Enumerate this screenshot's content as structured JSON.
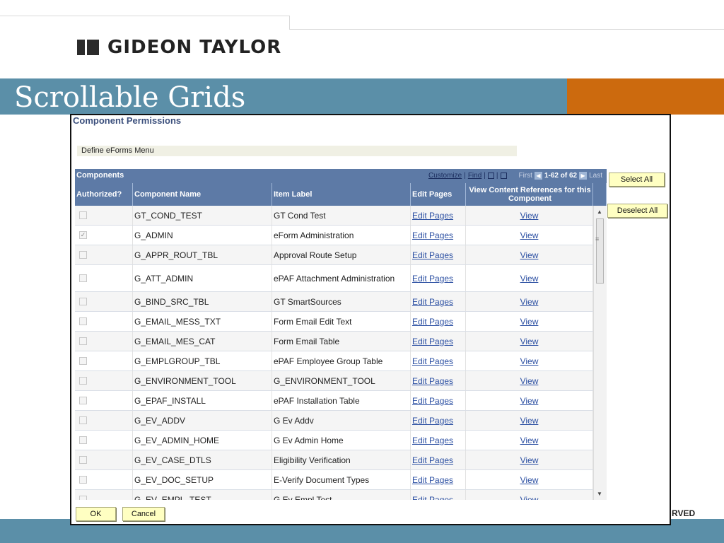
{
  "slide": {
    "logo_text": "GIDEON TAYLOR",
    "title": "Scrollable Grids",
    "footer_text": "RVED"
  },
  "page": {
    "title": "Component Permissions",
    "menu_label": "Define eForms Menu"
  },
  "grid": {
    "title": "Components",
    "nav": {
      "customize": "Customize",
      "find": "Find",
      "first": "First",
      "range": "1-62 of 62",
      "last": "Last"
    },
    "columns": [
      "Authorized?",
      "Component Name",
      "Item Label",
      "Edit Pages",
      "View Content References for this Component"
    ],
    "rows": [
      {
        "authorized": false,
        "component": "GT_COND_TEST",
        "label": "GT Cond Test",
        "edit": "Edit Pages",
        "view": "View"
      },
      {
        "authorized": true,
        "component": "G_ADMIN",
        "label": "eForm Administration",
        "edit": "Edit Pages",
        "view": "View"
      },
      {
        "authorized": false,
        "component": "G_APPR_ROUT_TBL",
        "label": "Approval Route Setup",
        "edit": "Edit Pages",
        "view": "View"
      },
      {
        "authorized": false,
        "component": "G_ATT_ADMIN",
        "label": "ePAF Attachment Administration",
        "edit": "Edit Pages",
        "view": "View"
      },
      {
        "authorized": false,
        "component": "G_BIND_SRC_TBL",
        "label": "GT SmartSources",
        "edit": "Edit Pages",
        "view": "View"
      },
      {
        "authorized": false,
        "component": "G_EMAIL_MESS_TXT",
        "label": "Form Email Edit Text",
        "edit": "Edit Pages",
        "view": "View"
      },
      {
        "authorized": false,
        "component": "G_EMAIL_MES_CAT",
        "label": "Form Email Table",
        "edit": "Edit Pages",
        "view": "View"
      },
      {
        "authorized": false,
        "component": "G_EMPLGROUP_TBL",
        "label": "ePAF Employee Group Table",
        "edit": "Edit Pages",
        "view": "View"
      },
      {
        "authorized": false,
        "component": "G_ENVIRONMENT_TOOL",
        "label": "G_ENVIRONMENT_TOOL",
        "edit": "Edit Pages",
        "view": "View"
      },
      {
        "authorized": false,
        "component": "G_EPAF_INSTALL",
        "label": "ePAF Installation Table",
        "edit": "Edit Pages",
        "view": "View"
      },
      {
        "authorized": false,
        "component": "G_EV_ADDV",
        "label": "G Ev Addv",
        "edit": "Edit Pages",
        "view": "View"
      },
      {
        "authorized": false,
        "component": "G_EV_ADMIN_HOME",
        "label": "G Ev Admin Home",
        "edit": "Edit Pages",
        "view": "View"
      },
      {
        "authorized": false,
        "component": "G_EV_CASE_DTLS",
        "label": "Eligibility Verification",
        "edit": "Edit Pages",
        "view": "View"
      },
      {
        "authorized": false,
        "component": "G_EV_DOC_SETUP",
        "label": "E-Verify Document Types",
        "edit": "Edit Pages",
        "view": "View"
      },
      {
        "authorized": false,
        "component": "G_EV_EMPL_TEST",
        "label": "G Ev Empl Test",
        "edit": "Edit Pages",
        "view": "View"
      }
    ]
  },
  "buttons": {
    "select_all": "Select All",
    "deselect_all": "Deselect All",
    "ok": "OK",
    "cancel": "Cancel"
  },
  "colors": {
    "band": "#5b8fa8",
    "accent": "#cc6a0e",
    "grid_header": "#5d7aa6",
    "button": "#ffffc2",
    "link": "#2b4fa2"
  }
}
